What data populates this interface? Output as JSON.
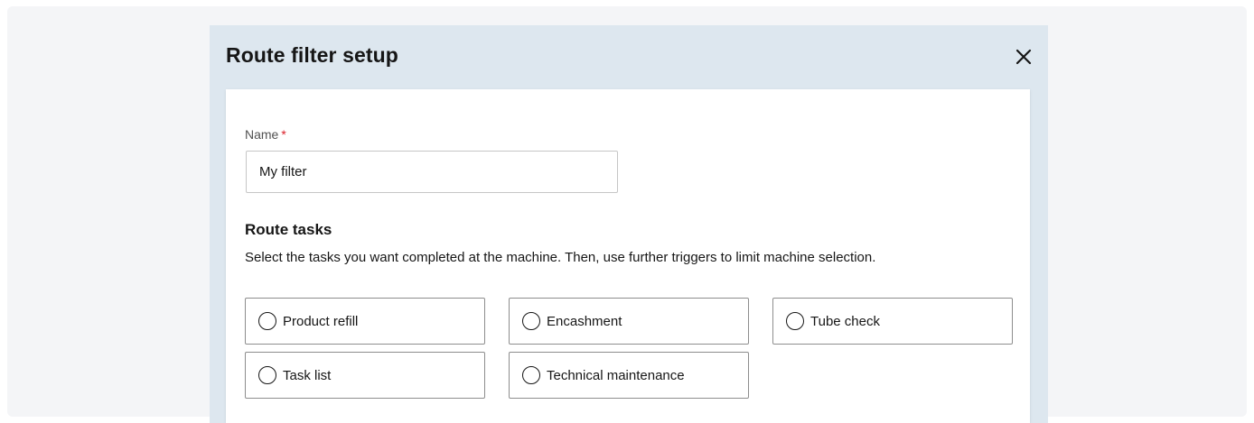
{
  "dialog": {
    "title": "Route filter setup",
    "close_icon": "close-icon"
  },
  "name_field": {
    "label": "Name",
    "required_marker": "*",
    "value": "My filter"
  },
  "route_tasks": {
    "title": "Route tasks",
    "description": "Select the tasks you want completed at the machine. Then, use further triggers to limit machine selection.",
    "options": [
      {
        "label": "Product refill",
        "selected": false
      },
      {
        "label": "Encashment",
        "selected": false
      },
      {
        "label": "Tube check",
        "selected": false
      },
      {
        "label": "Task list",
        "selected": false
      },
      {
        "label": "Technical maintenance",
        "selected": false
      }
    ]
  },
  "colors": {
    "header_bg": "#dde7ef",
    "required": "#da1e28"
  }
}
